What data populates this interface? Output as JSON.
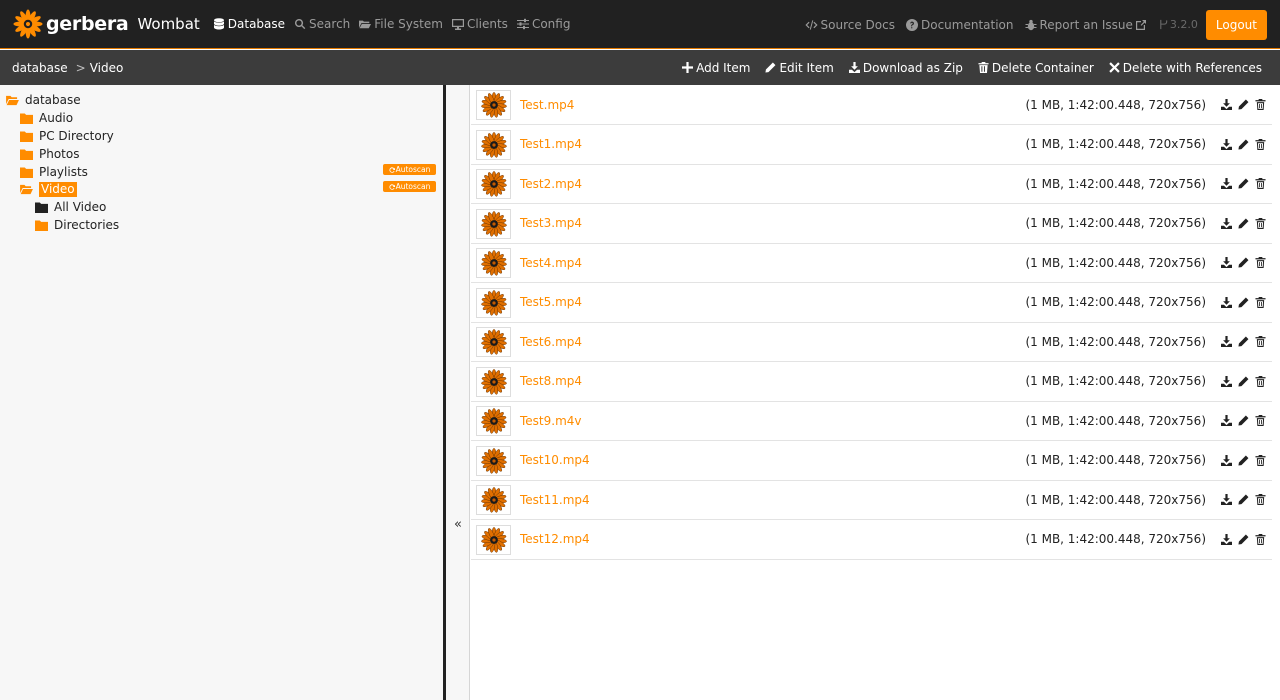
{
  "navbar": {
    "brand_name": "gerbera",
    "brand_sub": "Wombat",
    "items": [
      {
        "label": "Database",
        "icon": "database-icon",
        "active": true
      },
      {
        "label": "Search",
        "icon": "search-icon",
        "active": false
      },
      {
        "label": "File System",
        "icon": "folder-open-icon",
        "active": false
      },
      {
        "label": "Clients",
        "icon": "monitor-icon",
        "active": false
      },
      {
        "label": "Config",
        "icon": "sliders-icon",
        "active": false
      }
    ],
    "right": {
      "source_docs": "Source Docs",
      "documentation": "Documentation",
      "report_issue": "Report an Issue",
      "version": "3.2.0",
      "logout": "Logout"
    }
  },
  "toolbar": {
    "breadcrumb": [
      "database",
      "Video"
    ],
    "breadcrumb_sep": ">",
    "actions": [
      "Add Item",
      "Edit Item",
      "Download as Zip",
      "Delete Container",
      "Delete with References"
    ]
  },
  "tree": {
    "root": "database",
    "items": [
      {
        "label": "Audio",
        "autoscan": false
      },
      {
        "label": "PC Directory",
        "autoscan": false
      },
      {
        "label": "Photos",
        "autoscan": false
      },
      {
        "label": "Playlists",
        "autoscan": true
      },
      {
        "label": "Video",
        "autoscan": true,
        "selected": true,
        "open": true
      }
    ],
    "children": [
      {
        "label": "All Video",
        "dark": true
      },
      {
        "label": "Directories",
        "dark": false
      }
    ],
    "autoscan_label": "Autoscan"
  },
  "collapse_label": "«",
  "files": [
    {
      "name": "Test.mp4",
      "meta": "(1 MB, 1:42:00.448, 720x756)"
    },
    {
      "name": "Test1.mp4",
      "meta": "(1 MB, 1:42:00.448, 720x756)"
    },
    {
      "name": "Test2.mp4",
      "meta": "(1 MB, 1:42:00.448, 720x756)"
    },
    {
      "name": "Test3.mp4",
      "meta": "(1 MB, 1:42:00.448, 720x756)"
    },
    {
      "name": "Test4.mp4",
      "meta": "(1 MB, 1:42:00.448, 720x756)"
    },
    {
      "name": "Test5.mp4",
      "meta": "(1 MB, 1:42:00.448, 720x756)"
    },
    {
      "name": "Test6.mp4",
      "meta": "(1 MB, 1:42:00.448, 720x756)"
    },
    {
      "name": "Test8.mp4",
      "meta": "(1 MB, 1:42:00.448, 720x756)"
    },
    {
      "name": "Test9.m4v",
      "meta": "(1 MB, 1:42:00.448, 720x756)"
    },
    {
      "name": "Test10.mp4",
      "meta": "(1 MB, 1:42:00.448, 720x756)"
    },
    {
      "name": "Test11.mp4",
      "meta": "(1 MB, 1:42:00.448, 720x756)"
    },
    {
      "name": "Test12.mp4",
      "meta": "(1 MB, 1:42:00.448, 720x756)"
    }
  ],
  "colors": {
    "accent": "#ff8c00",
    "navbar_bg": "#212121",
    "toolbar_bg": "#3c3c3c",
    "tree_bg": "#f7f7f7"
  }
}
